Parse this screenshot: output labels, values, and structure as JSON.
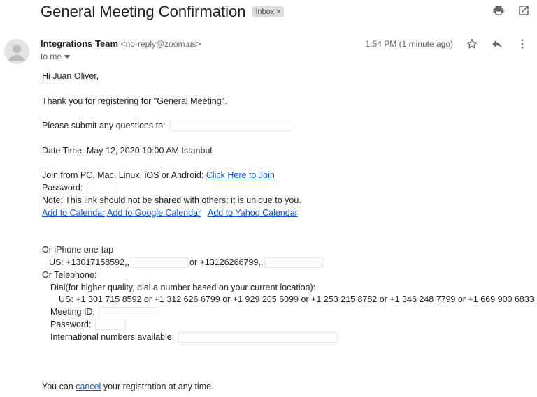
{
  "subject": "General Meeting Confirmation",
  "label_badge": {
    "text": "Inbox",
    "close": "×"
  },
  "sender": {
    "name": "Integrations Team",
    "email": "<no-reply@zoom.us>",
    "to": "to me"
  },
  "timestamp": "1:54 PM (1 minute ago)",
  "icons": [
    "print-icon",
    "open-in-new-window-icon",
    "avatar-person-icon",
    "star-icon",
    "reply-icon",
    "more-vert-icon",
    "chevron-down-icon"
  ],
  "message": {
    "greeting": "Hi Juan Oliver,",
    "thanks": "Thank you for registering for \"General Meeting\".",
    "questions_label": "Please submit any questions to:",
    "date_time": "Date Time: May 12, 2020 10:00 AM Istanbul",
    "join_label": "Join from PC, Mac, Linux, iOS or Android: ",
    "join_link": "Click Here to Join",
    "password_label": "Password:",
    "note": "Note: This link should not be shared with others; it is unique to you.",
    "calendar_links": [
      "Add to Calendar",
      "Add to Google Calendar",
      "Add to Yahoo Calendar"
    ],
    "iphone_label": "Or iPhone one-tap",
    "us_onetap_1": "US: +13017158592,,",
    "us_onetap_or": "or +13126266799,,",
    "telephone_label": "Or Telephone:",
    "dial_label": "Dial(for higher quality, dial a number based on your current location):",
    "us_numbers": "US: +1 301 715 8592 or +1 312 626 6799 or +1 929 205 6099 or +1 253 215 8782 or +1 346 248 7799 or +1 669 900 6833",
    "meeting_id_label": "Meeting ID:",
    "tel_password_label": "Password:",
    "intl_label": "International numbers available:",
    "cancel_prefix": "You can ",
    "cancel_link": "cancel",
    "cancel_suffix": " your registration at any time."
  }
}
